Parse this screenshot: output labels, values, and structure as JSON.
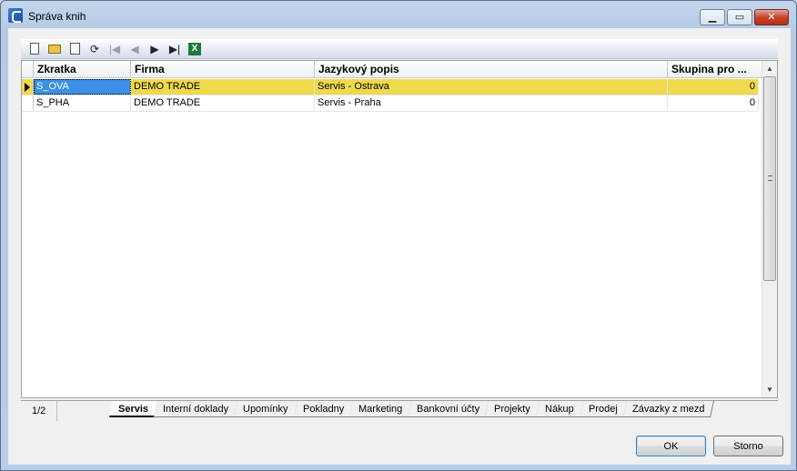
{
  "window": {
    "title": "Správa knih"
  },
  "toolbar": {
    "buttons": [
      {
        "icon": "new-document-icon",
        "enabled": true
      },
      {
        "icon": "open-folder-icon",
        "enabled": true
      },
      {
        "icon": "delete-icon",
        "enabled": true
      },
      {
        "icon": "refresh-icon",
        "enabled": true
      },
      {
        "icon": "first-record-icon",
        "glyph": "|◀",
        "enabled": false
      },
      {
        "icon": "previous-record-icon",
        "glyph": "◀",
        "enabled": false
      },
      {
        "icon": "next-record-icon",
        "glyph": "▶",
        "enabled": true
      },
      {
        "icon": "last-record-icon",
        "glyph": "▶|",
        "enabled": true
      },
      {
        "icon": "export-excel-icon",
        "glyph": "X",
        "enabled": true
      }
    ]
  },
  "grid": {
    "columns": [
      "Zkratka",
      "Firma",
      "Jazykový popis",
      "Skupina pro ..."
    ],
    "rows": [
      {
        "zkratka": "S_OVA",
        "firma": "DEMO TRADE",
        "popis": "Servis - Ostrava",
        "skupina": "0",
        "selected": true
      },
      {
        "zkratka": "S_PHA",
        "firma": "DEMO TRADE",
        "popis": "Servis - Praha",
        "skupina": "0",
        "selected": false
      }
    ]
  },
  "pager": {
    "count": "1/2"
  },
  "tabs": [
    {
      "label": "Servis",
      "active": true
    },
    {
      "label": "Interní doklady",
      "active": false
    },
    {
      "label": "Upomínky",
      "active": false
    },
    {
      "label": "Pokladny",
      "active": false
    },
    {
      "label": "Marketing",
      "active": false
    },
    {
      "label": "Bankovní účty",
      "active": false
    },
    {
      "label": "Projekty",
      "active": false
    },
    {
      "label": "Nákup",
      "active": false
    },
    {
      "label": "Prodej",
      "active": false
    },
    {
      "label": "Závazky z mezd",
      "active": false
    }
  ],
  "buttons": {
    "ok": "OK",
    "cancel": "Storno"
  },
  "colors": {
    "selected_row": "#efd94e",
    "focused_cell": "#3b8fe4"
  }
}
